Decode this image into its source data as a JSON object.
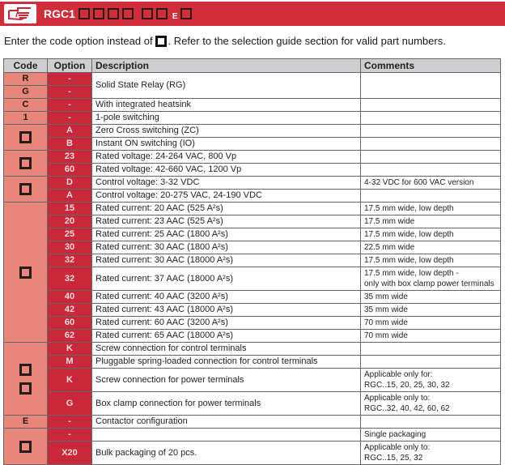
{
  "banner": {
    "code_prefix": "RGC1",
    "e_letter": "E",
    "icon": "pointing-hand-icon",
    "colors": {
      "banner": "#d12e3c",
      "code_cell": "#e8867c",
      "option_cell": "#c8283a",
      "header": "#cfcfd1"
    }
  },
  "intro": {
    "before": "Enter the code option instead of",
    "after": ". Refer to the selection guide section for valid part numbers."
  },
  "table": {
    "headers": {
      "code": "Code",
      "option": "Option",
      "description": "Description",
      "comments": "Comments"
    },
    "rows": [
      {
        "code": "R",
        "option": "-",
        "description": "Solid State Relay (RG)",
        "comments": ""
      },
      {
        "code": "G",
        "option": "-",
        "description": "",
        "comments": ""
      },
      {
        "code": "C",
        "option": "-",
        "description": "With integrated heatsink",
        "comments": ""
      },
      {
        "code": "1",
        "option": "-",
        "description": "1-pole switching",
        "comments": ""
      },
      {
        "code": "",
        "option": "A",
        "description": "Zero Cross switching (ZC)",
        "comments": ""
      },
      {
        "code": "",
        "option": "B",
        "description": "Instant ON switching (IO)",
        "comments": ""
      },
      {
        "code": "",
        "option": "23",
        "description": "Rated voltage: 24-264 VAC, 800 Vp",
        "comments": ""
      },
      {
        "code": "",
        "option": "60",
        "description": "Rated voltage: 42-660 VAC, 1200 Vp",
        "comments": ""
      },
      {
        "code": "",
        "option": "D",
        "description": "Control voltage: 3-32 VDC",
        "comments": "4-32 VDC for 600 VAC version"
      },
      {
        "code": "",
        "option": "A",
        "description": "Control voltage: 20-275 VAC, 24-190 VDC",
        "comments": ""
      },
      {
        "code": "",
        "option": "15",
        "description": "Rated current: 20 AAC (525 A²s)",
        "comments": "17.5 mm wide, low depth"
      },
      {
        "code": "",
        "option": "20",
        "description": "Rated current: 23 AAC (525 A²s)",
        "comments": "17.5 mm wide"
      },
      {
        "code": "",
        "option": "25",
        "description": "Rated current: 25 AAC (1800 A²s)",
        "comments": "17.5 mm wide, low depth"
      },
      {
        "code": "",
        "option": "30",
        "description": "Rated current: 30 AAC (1800 A²s)",
        "comments": "22.5 mm wide"
      },
      {
        "code": "",
        "option": "32",
        "description": "Rated current: 30 AAC (18000 A²s)",
        "comments": "17.5 mm wide, low depth"
      },
      {
        "code": "",
        "option": "32",
        "description": "Rated current: 37 AAC (18000 A²s)",
        "comments": "17.5 mm wide, low depth -",
        "comments2": "only with box clamp power terminals"
      },
      {
        "code": "",
        "option": "40",
        "description": "Rated current: 40 AAC (3200 A²s)",
        "comments": "35 mm wide"
      },
      {
        "code": "",
        "option": "42",
        "description": "Rated current: 43 AAC (18000 A²s)",
        "comments": "35 mm wide"
      },
      {
        "code": "",
        "option": "60",
        "description": "Rated current: 60 AAC (3200 A²s)",
        "comments": "70 mm wide"
      },
      {
        "code": "",
        "option": "62",
        "description": "Rated current: 65 AAC (18000 A²s)",
        "comments": "70 mm wide"
      },
      {
        "code": "",
        "option": "K",
        "description": "Screw connection for control terminals",
        "comments": ""
      },
      {
        "code": "",
        "option": "M",
        "description": "Pluggable spring-loaded connection for control terminals",
        "comments": ""
      },
      {
        "code": "",
        "option": "K",
        "description": "Screw connection for power terminals",
        "comments": "Applicable only for:",
        "comments2": "RGC..15, 20, 25, 30, 32"
      },
      {
        "code": "",
        "option": "G",
        "description": "Box clamp connection for power terminals",
        "comments": "Applicable only to:",
        "comments2": "RGC..32, 40, 42, 60, 62"
      },
      {
        "code": "E",
        "option": "-",
        "description": "Contactor configuration",
        "comments": ""
      },
      {
        "code": "",
        "option": "-",
        "description": "",
        "comments": "Single packaging"
      },
      {
        "code": "",
        "option": "X20",
        "description": "Bulk packaging of 20 pcs.",
        "comments": "Applicable only to:",
        "comments2": "RGC..15, 25, 32"
      }
    ]
  }
}
